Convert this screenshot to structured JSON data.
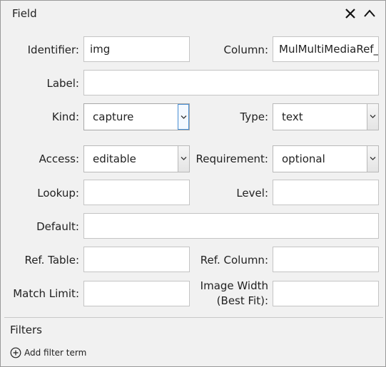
{
  "header": {
    "title": "Field"
  },
  "labels": {
    "identifier": "Identifier:",
    "column": "Column:",
    "label": "Label:",
    "kind": "Kind:",
    "type": "Type:",
    "access": "Access:",
    "requirement": "Requirement:",
    "lookup": "Lookup:",
    "level": "Level:",
    "default": "Default:",
    "ref_table": "Ref. Table:",
    "ref_column": "Ref. Column:",
    "match_limit": "Match Limit:",
    "image_width_line1": "Image Width",
    "image_width_line2": "(Best Fit):"
  },
  "values": {
    "identifier": "img",
    "column": "MulMultiMediaRef_",
    "label": "",
    "kind": "capture",
    "type": "text",
    "access": "editable",
    "requirement": "optional",
    "lookup": "",
    "level": "",
    "default": "",
    "ref_table": "",
    "ref_column": "",
    "match_limit": "",
    "image_width": ""
  },
  "filters": {
    "title": "Filters",
    "add_label": "Add filter term"
  }
}
